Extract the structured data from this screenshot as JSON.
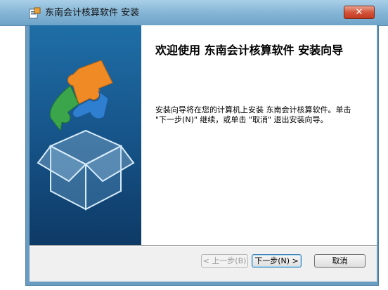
{
  "window": {
    "title": "东南会计核算软件 安装",
    "close_symbol": "✕"
  },
  "content": {
    "heading": "欢迎使用 东南会计核算软件 安装向导",
    "description": "安装向导将在您的计算机上安装 东南会计核算软件。单击 \"下一步(N)\" 继续，或单击 \"取消\" 退出安装向导。"
  },
  "buttons": {
    "back": "< 上一步(B)",
    "next": "下一步(N) >",
    "cancel": "取消"
  },
  "icons": {
    "app": "installer-icon",
    "banner": "puzzle-box-icon"
  },
  "colors": {
    "title_bar": "#88b8d8",
    "banner": "#17578d",
    "puzzle_orange": "#f08a24",
    "puzzle_green": "#3aa54a",
    "puzzle_blue": "#2f7fd0"
  }
}
